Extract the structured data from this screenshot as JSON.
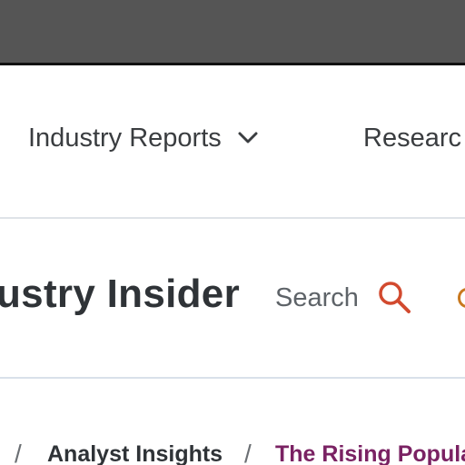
{
  "nav": {
    "items": [
      {
        "label": "Industry Reports",
        "icon": "chevron-down-icon"
      },
      {
        "label": "Researc"
      }
    ]
  },
  "header": {
    "site_title": "ustry Insider",
    "search_label": "Search",
    "search_icon": "search-icon",
    "colors": {
      "search_icon": "#d24a2f",
      "edge_icon": "#c9791f",
      "top_bar": "#555555"
    }
  },
  "breadcrumb": {
    "separator": "/",
    "items": [
      {
        "label": "Analyst Insights"
      },
      {
        "label": "The Rising Popula",
        "current": true,
        "color": "#7a2263"
      }
    ]
  }
}
